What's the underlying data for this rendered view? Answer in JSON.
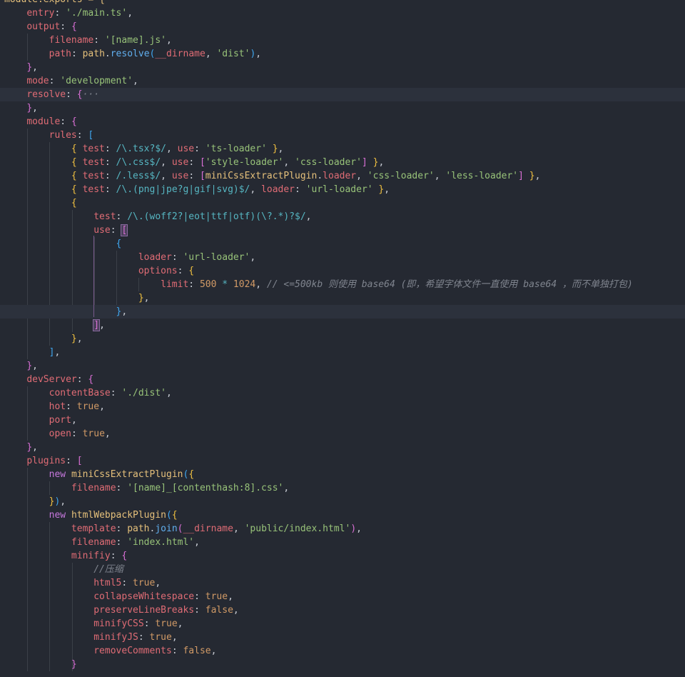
{
  "theme": {
    "background": "#252932",
    "active_line": "#2c313c",
    "colors": {
      "prop": "#e06c75",
      "str": "#98c379",
      "num": "#d19a66",
      "kw": "#c678dd",
      "fn": "#61afef",
      "id": "#e5c07b",
      "op": "#56b6c2",
      "com": "#7f848e",
      "br1": "#f0c040",
      "br2": "#da70d6",
      "br3": "#3fa7f0",
      "pl": "#c8ccd4"
    }
  },
  "lines": [
    [
      [
        "module.exports = {",
        "id"
      ]
    ],
    [
      [
        "    ",
        "pl"
      ],
      [
        "entry",
        "prop"
      ],
      [
        ": ",
        "pl"
      ],
      [
        "'./main.ts'",
        "str"
      ],
      [
        ",",
        "pl"
      ]
    ],
    [
      [
        "    ",
        "pl"
      ],
      [
        "output",
        "prop"
      ],
      [
        ": ",
        "pl"
      ],
      [
        "{",
        "br2"
      ]
    ],
    [
      [
        "        ",
        "pl"
      ],
      [
        "filename",
        "prop"
      ],
      [
        ": ",
        "pl"
      ],
      [
        "'[name].js'",
        "str"
      ],
      [
        ",",
        "pl"
      ]
    ],
    [
      [
        "        ",
        "pl"
      ],
      [
        "path",
        "prop"
      ],
      [
        ": ",
        "pl"
      ],
      [
        "path",
        "id"
      ],
      [
        ".",
        "pl"
      ],
      [
        "resolve",
        "fn"
      ],
      [
        "(",
        "br3"
      ],
      [
        "__dirname",
        "prop"
      ],
      [
        ", ",
        "pl"
      ],
      [
        "'dist'",
        "str"
      ],
      [
        ")",
        "br3"
      ],
      [
        ",",
        "pl"
      ]
    ],
    [
      [
        "    ",
        "pl"
      ],
      [
        "}",
        "br2"
      ],
      [
        ",",
        "pl"
      ]
    ],
    [
      [
        "    ",
        "pl"
      ],
      [
        "mode",
        "prop"
      ],
      [
        ": ",
        "pl"
      ],
      [
        "'development'",
        "str"
      ],
      [
        ",",
        "pl"
      ]
    ],
    [
      [
        "    ",
        "pl"
      ],
      [
        "resolve",
        "prop"
      ],
      [
        ": ",
        "pl"
      ],
      [
        "{",
        "br2"
      ],
      [
        "···",
        "com"
      ]
    ],
    [
      [
        "    ",
        "pl"
      ],
      [
        "}",
        "br2"
      ],
      [
        ",",
        "pl"
      ]
    ],
    [
      [
        "    ",
        "pl"
      ],
      [
        "module",
        "prop"
      ],
      [
        ": ",
        "pl"
      ],
      [
        "{",
        "br2"
      ]
    ],
    [
      [
        "        ",
        "pl"
      ],
      [
        "rules",
        "prop"
      ],
      [
        ": ",
        "pl"
      ],
      [
        "[",
        "br3"
      ]
    ],
    [
      [
        "            ",
        "pl"
      ],
      [
        "{",
        "br1"
      ],
      [
        " ",
        "pl"
      ],
      [
        "test",
        "prop"
      ],
      [
        ": ",
        "pl"
      ],
      [
        "/\\.tsx?$/",
        "op"
      ],
      [
        ", ",
        "pl"
      ],
      [
        "use",
        "prop"
      ],
      [
        ": ",
        "pl"
      ],
      [
        "'ts-loader'",
        "str"
      ],
      [
        " ",
        "pl"
      ],
      [
        "}",
        "br1"
      ],
      [
        ",",
        "pl"
      ]
    ],
    [
      [
        "            ",
        "pl"
      ],
      [
        "{",
        "br1"
      ],
      [
        " ",
        "pl"
      ],
      [
        "test",
        "prop"
      ],
      [
        ": ",
        "pl"
      ],
      [
        "/\\.css$/",
        "op"
      ],
      [
        ", ",
        "pl"
      ],
      [
        "use",
        "prop"
      ],
      [
        ": ",
        "pl"
      ],
      [
        "[",
        "br2"
      ],
      [
        "'style-loader'",
        "str"
      ],
      [
        ", ",
        "pl"
      ],
      [
        "'css-loader'",
        "str"
      ],
      [
        "]",
        "br2"
      ],
      [
        " ",
        "pl"
      ],
      [
        "}",
        "br1"
      ],
      [
        ",",
        "pl"
      ]
    ],
    [
      [
        "            ",
        "pl"
      ],
      [
        "{",
        "br1"
      ],
      [
        " ",
        "pl"
      ],
      [
        "test",
        "prop"
      ],
      [
        ": ",
        "pl"
      ],
      [
        "/.less$/",
        "op"
      ],
      [
        ", ",
        "pl"
      ],
      [
        "use",
        "prop"
      ],
      [
        ": ",
        "pl"
      ],
      [
        "[",
        "br2"
      ],
      [
        "miniCssExtractPlugin",
        "id"
      ],
      [
        ".",
        "pl"
      ],
      [
        "loader",
        "prop"
      ],
      [
        ", ",
        "pl"
      ],
      [
        "'css-loader'",
        "str"
      ],
      [
        ", ",
        "pl"
      ],
      [
        "'less-loader'",
        "str"
      ],
      [
        "]",
        "br2"
      ],
      [
        " ",
        "pl"
      ],
      [
        "}",
        "br1"
      ],
      [
        ",",
        "pl"
      ]
    ],
    [
      [
        "            ",
        "pl"
      ],
      [
        "{",
        "br1"
      ],
      [
        " ",
        "pl"
      ],
      [
        "test",
        "prop"
      ],
      [
        ": ",
        "pl"
      ],
      [
        "/\\.(png|jpe?g|gif|svg)$/",
        "op"
      ],
      [
        ", ",
        "pl"
      ],
      [
        "loader",
        "prop"
      ],
      [
        ": ",
        "pl"
      ],
      [
        "'url-loader'",
        "str"
      ],
      [
        " ",
        "pl"
      ],
      [
        "}",
        "br1"
      ],
      [
        ",",
        "pl"
      ]
    ],
    [
      [
        "            ",
        "pl"
      ],
      [
        "{",
        "br1"
      ]
    ],
    [
      [
        "                ",
        "pl"
      ],
      [
        "test",
        "prop"
      ],
      [
        ": ",
        "pl"
      ],
      [
        "/\\.(woff2?|eot|ttf|otf)(\\?.*)?$/",
        "op"
      ],
      [
        ",",
        "pl"
      ]
    ],
    [
      [
        "                ",
        "pl"
      ],
      [
        "use",
        "prop"
      ],
      [
        ": ",
        "pl"
      ],
      [
        "[",
        "br2"
      ]
    ],
    [
      [
        "                    ",
        "pl"
      ],
      [
        "{",
        "br3"
      ]
    ],
    [
      [
        "                        ",
        "pl"
      ],
      [
        "loader",
        "prop"
      ],
      [
        ": ",
        "pl"
      ],
      [
        "'url-loader'",
        "str"
      ],
      [
        ",",
        "pl"
      ]
    ],
    [
      [
        "                        ",
        "pl"
      ],
      [
        "options",
        "prop"
      ],
      [
        ": ",
        "pl"
      ],
      [
        "{",
        "br1"
      ]
    ],
    [
      [
        "                            ",
        "pl"
      ],
      [
        "limit",
        "prop"
      ],
      [
        ": ",
        "pl"
      ],
      [
        "500",
        "num"
      ],
      [
        " ",
        "pl"
      ],
      [
        "*",
        "op"
      ],
      [
        " ",
        "pl"
      ],
      [
        "1024",
        "num"
      ],
      [
        ", ",
        "pl"
      ],
      [
        "// <=500kb 则使用 base64 (即，希望字体文件一直使用 base64 ，而不单独打包)",
        "com"
      ]
    ],
    [
      [
        "                        ",
        "pl"
      ],
      [
        "}",
        "br1"
      ],
      [
        ",",
        "pl"
      ]
    ],
    [
      [
        "                    ",
        "pl"
      ],
      [
        "}",
        "br3"
      ],
      [
        ",",
        "pl"
      ]
    ],
    [
      [
        "                ",
        "pl"
      ],
      [
        "]",
        "br2"
      ],
      [
        ",",
        "pl"
      ]
    ],
    [
      [
        "            ",
        "pl"
      ],
      [
        "}",
        "br1"
      ],
      [
        ",",
        "pl"
      ]
    ],
    [
      [
        "        ",
        "pl"
      ],
      [
        "]",
        "br3"
      ],
      [
        ",",
        "pl"
      ]
    ],
    [
      [
        "    ",
        "pl"
      ],
      [
        "}",
        "br2"
      ],
      [
        ",",
        "pl"
      ]
    ],
    [
      [
        "    ",
        "pl"
      ],
      [
        "devServer",
        "prop"
      ],
      [
        ": ",
        "pl"
      ],
      [
        "{",
        "br2"
      ]
    ],
    [
      [
        "        ",
        "pl"
      ],
      [
        "contentBase",
        "prop"
      ],
      [
        ": ",
        "pl"
      ],
      [
        "'./dist'",
        "str"
      ],
      [
        ",",
        "pl"
      ]
    ],
    [
      [
        "        ",
        "pl"
      ],
      [
        "hot",
        "prop"
      ],
      [
        ": ",
        "pl"
      ],
      [
        "true",
        "num"
      ],
      [
        ",",
        "pl"
      ]
    ],
    [
      [
        "        ",
        "pl"
      ],
      [
        "port",
        "prop"
      ],
      [
        ",",
        "pl"
      ]
    ],
    [
      [
        "        ",
        "pl"
      ],
      [
        "open",
        "prop"
      ],
      [
        ": ",
        "pl"
      ],
      [
        "true",
        "num"
      ],
      [
        ",",
        "pl"
      ]
    ],
    [
      [
        "    ",
        "pl"
      ],
      [
        "}",
        "br2"
      ],
      [
        ",",
        "pl"
      ]
    ],
    [
      [
        "    ",
        "pl"
      ],
      [
        "plugins",
        "prop"
      ],
      [
        ": ",
        "pl"
      ],
      [
        "[",
        "br2"
      ]
    ],
    [
      [
        "        ",
        "pl"
      ],
      [
        "new",
        "kw"
      ],
      [
        " ",
        "pl"
      ],
      [
        "miniCssExtractPlugin",
        "id"
      ],
      [
        "(",
        "br3"
      ],
      [
        "{",
        "br1"
      ]
    ],
    [
      [
        "            ",
        "pl"
      ],
      [
        "filename",
        "prop"
      ],
      [
        ": ",
        "pl"
      ],
      [
        "'[name]_[contenthash:8].css'",
        "str"
      ],
      [
        ",",
        "pl"
      ]
    ],
    [
      [
        "        ",
        "pl"
      ],
      [
        "}",
        "br1"
      ],
      [
        ")",
        "br3"
      ],
      [
        ",",
        "pl"
      ]
    ],
    [
      [
        "        ",
        "pl"
      ],
      [
        "new",
        "kw"
      ],
      [
        " ",
        "pl"
      ],
      [
        "htmlWebpackPlugin",
        "id"
      ],
      [
        "(",
        "br3"
      ],
      [
        "{",
        "br1"
      ]
    ],
    [
      [
        "            ",
        "pl"
      ],
      [
        "template",
        "prop"
      ],
      [
        ": ",
        "pl"
      ],
      [
        "path",
        "id"
      ],
      [
        ".",
        "pl"
      ],
      [
        "join",
        "fn"
      ],
      [
        "(",
        "br2"
      ],
      [
        "__dirname",
        "prop"
      ],
      [
        ", ",
        "pl"
      ],
      [
        "'public/index.html'",
        "str"
      ],
      [
        ")",
        "br2"
      ],
      [
        ",",
        "pl"
      ]
    ],
    [
      [
        "            ",
        "pl"
      ],
      [
        "filename",
        "prop"
      ],
      [
        ": ",
        "pl"
      ],
      [
        "'index.html'",
        "str"
      ],
      [
        ",",
        "pl"
      ]
    ],
    [
      [
        "            ",
        "pl"
      ],
      [
        "minifiy",
        "prop"
      ],
      [
        ": ",
        "pl"
      ],
      [
        "{",
        "br2"
      ]
    ],
    [
      [
        "                ",
        "pl"
      ],
      [
        "//压缩",
        "com"
      ]
    ],
    [
      [
        "                ",
        "pl"
      ],
      [
        "html5",
        "prop"
      ],
      [
        ": ",
        "pl"
      ],
      [
        "true",
        "num"
      ],
      [
        ",",
        "pl"
      ]
    ],
    [
      [
        "                ",
        "pl"
      ],
      [
        "collapseWhitespace",
        "prop"
      ],
      [
        ": ",
        "pl"
      ],
      [
        "true",
        "num"
      ],
      [
        ",",
        "pl"
      ]
    ],
    [
      [
        "                ",
        "pl"
      ],
      [
        "preserveLineBreaks",
        "prop"
      ],
      [
        ": ",
        "pl"
      ],
      [
        "false",
        "num"
      ],
      [
        ",",
        "pl"
      ]
    ],
    [
      [
        "                ",
        "pl"
      ],
      [
        "minifyCSS",
        "prop"
      ],
      [
        ": ",
        "pl"
      ],
      [
        "true",
        "num"
      ],
      [
        ",",
        "pl"
      ]
    ],
    [
      [
        "                ",
        "pl"
      ],
      [
        "minifyJS",
        "prop"
      ],
      [
        ": ",
        "pl"
      ],
      [
        "true",
        "num"
      ],
      [
        ",",
        "pl"
      ]
    ],
    [
      [
        "                ",
        "pl"
      ],
      [
        "removeComments",
        "prop"
      ],
      [
        ": ",
        "pl"
      ],
      [
        "false",
        "num"
      ],
      [
        ",",
        "pl"
      ]
    ],
    [
      [
        "            ",
        "pl"
      ],
      [
        "}",
        "br2"
      ]
    ]
  ]
}
